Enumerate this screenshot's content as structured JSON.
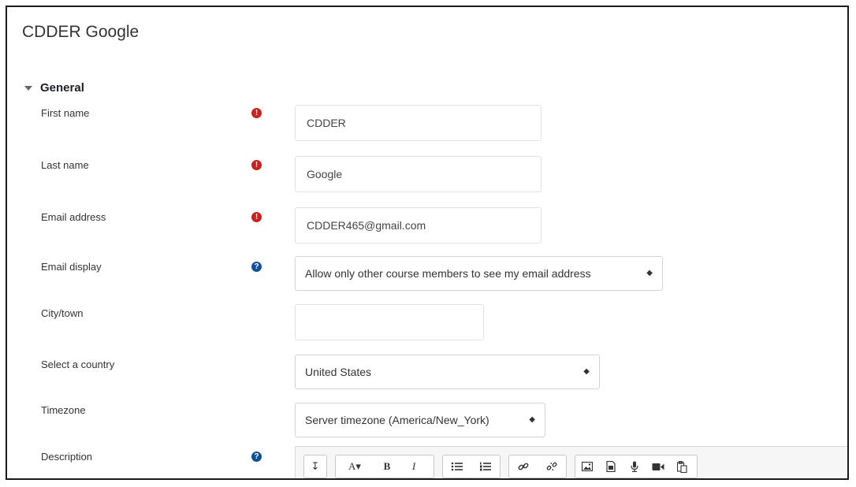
{
  "page": {
    "title": "CDDER Google"
  },
  "section": {
    "title": "General"
  },
  "fields": {
    "first_name": {
      "label": "First name",
      "value": "CDDER"
    },
    "last_name": {
      "label": "Last name",
      "value": "Google"
    },
    "email": {
      "label": "Email address",
      "value": "CDDER465@gmail.com"
    },
    "email_display": {
      "label": "Email display",
      "value": "Allow only other course members to see my email address"
    },
    "city": {
      "label": "City/town",
      "value": ""
    },
    "country": {
      "label": "Select a country",
      "value": "United States"
    },
    "timezone": {
      "label": "Timezone",
      "value": "Server timezone (America/New_York)"
    },
    "description": {
      "label": "Description"
    }
  },
  "badges": {
    "required": "!",
    "help": "?"
  },
  "select_caret": "◆",
  "toolbar": {
    "collapse": "↧",
    "font": "A▾",
    "bold": "B",
    "italic": "I"
  },
  "colors": {
    "required": "#c9211e",
    "help": "#0f5196",
    "frame": "#1b1b1b"
  }
}
